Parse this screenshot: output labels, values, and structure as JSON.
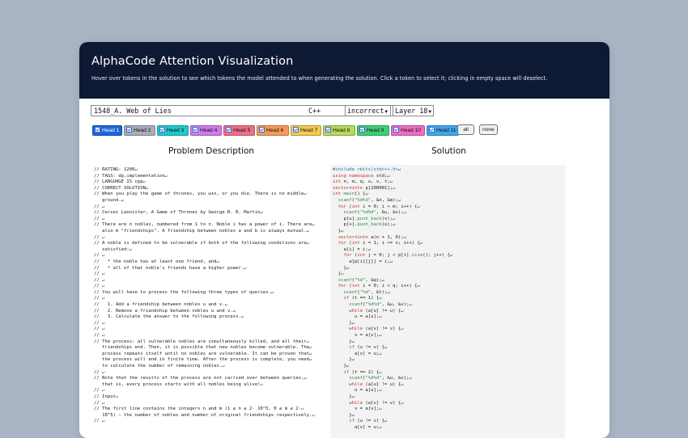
{
  "header": {
    "title": "AlphaCode Attention Visualization",
    "subtitle": "Hover over tokens in the solution to see which tokens the model attended to when generating the solution. Click a token to select it; clicking in empty space will deselect."
  },
  "controls": {
    "problem_name": "1548_A. Web of Lies",
    "language": "C++",
    "correctness": "incorrect",
    "layer": "Layer 18"
  },
  "heads": [
    {
      "label": "Head 1",
      "color": "#1a66d9",
      "text_color": "#ffffff"
    },
    {
      "label": "Head 2",
      "color": "#a7aeb8",
      "text_color": "#111111"
    },
    {
      "label": "Head 3",
      "color": "#1fc9c9",
      "text_color": "#111111"
    },
    {
      "label": "Head 4",
      "color": "#cf7be8",
      "text_color": "#111111"
    },
    {
      "label": "Head 5",
      "color": "#ef6e86",
      "text_color": "#111111"
    },
    {
      "label": "Head 6",
      "color": "#f59a5a",
      "text_color": "#111111"
    },
    {
      "label": "Head 7",
      "color": "#f3cb4e",
      "text_color": "#111111"
    },
    {
      "label": "Head 8",
      "color": "#b6da5a",
      "text_color": "#111111"
    },
    {
      "label": "Head 9",
      "color": "#3fcf73",
      "text_color": "#111111"
    },
    {
      "label": "Head 10",
      "color": "#f06cc3",
      "text_color": "#111111"
    },
    {
      "label": "Head 11",
      "color": "#3ea9e8",
      "text_color": "#111111"
    }
  ],
  "buttons": {
    "all": "all",
    "none": "none"
  },
  "titles": {
    "problem": "Problem Description",
    "solution": "Solution"
  },
  "problem_lines": [
    "// RATING: 1200",
    "// TAGS: dp,implementation",
    "// LANGUAGE IS cpp",
    "// CORRECT SOLUTION",
    "// When you play the game of thrones, you win, or you die. There is no middle",
    "   ground.",
    "// ",
    "// Cersei Lannister, A Game of Thrones by George R. R. Martin",
    "// ",
    "// There are n nobles, numbered from 1 to n. Noble i has a power of i. There are",
    "   also m \"friendships\". A friendship between nobles a and b is always mutual.",
    "// ",
    "// A noble is defined to be vulnerable if both of the following conditions are",
    "   satisfied:",
    "// ",
    "//   * the noble has at least one friend, and",
    "//   * all of that noble's friends have a higher power.",
    "// ",
    "// ",
    "// ",
    "// You will have to process the following three types of queries.",
    "// ",
    "//   1. Add a friendship between nobles u and v.",
    "//   2. Remove a friendship between nobles u and v.",
    "//   3. Calculate the answer to the following process.",
    "// ",
    "// ",
    "// ",
    "// The process: all vulnerable nobles are simultaneously killed, and all their",
    "   friendships end. Then, it is possible that new nobles become vulnerable. The",
    "   process repeats itself until no nobles are vulnerable. It can be proven that",
    "   the process will end in finite time. After the process is complete, you need",
    "   to calculate the number of remaining nobles.",
    "// ",
    "// Note that the results of the process are not carried over between queries,",
    "   that is, every process starts with all nobles being alive!",
    "// ",
    "// Input",
    "// ",
    "// The first line contains the integers n and m (1 ≤ n ≤ 2· 10^5, 0 ≤ m ≤ 2·",
    "   10^5) — the number of nobles and number of original friendships respectively.",
    "// "
  ],
  "solution_lines": [
    "#include <bits/stdc++.h>",
    "using namespace std;",
    "int n, m, q, u, v, t;",
    "vector<int> p[200001];",
    "int main() {",
    "  scanf(\"%d%d\", &n, &m);",
    "  for (int i = 0; i < m; i++) {",
    "    scanf(\"%d%d\", &u, &v);",
    "    p[u].push_back(v);",
    "    p[v].push_back(u);",
    "  }",
    "  vector<int> a(n + 1, 0);",
    "  for (int i = 1; i <= n; i++) {",
    "    a[i] = i;",
    "    for (int j = 0; j < p[i].size(); j++) {",
    "      a[p[i][j]] = i;",
    "    }",
    "  }",
    "  scanf(\"%d\", &q);",
    "  for (int i = 0; i < q; i++) {",
    "    scanf(\"%d\", &t);",
    "    if (t == 1) {",
    "      scanf(\"%d%d\", &u, &v);",
    "      while (a[u] != u) {",
    "        u = a[u];",
    "      }",
    "      while (a[v] != v) {",
    "        v = a[v];",
    "      }",
    "      if (u != v) {",
    "        a[v] = u;",
    "      }",
    "    }",
    "    if (t == 2) {",
    "      scanf(\"%d%d\", &u, &v);",
    "      while (a[u] != u) {",
    "        u = a[u];",
    "      }",
    "      while (a[v] != v) {",
    "        v = a[v];",
    "      }",
    "      if (u != v) {",
    "        a[v] = u;"
  ]
}
